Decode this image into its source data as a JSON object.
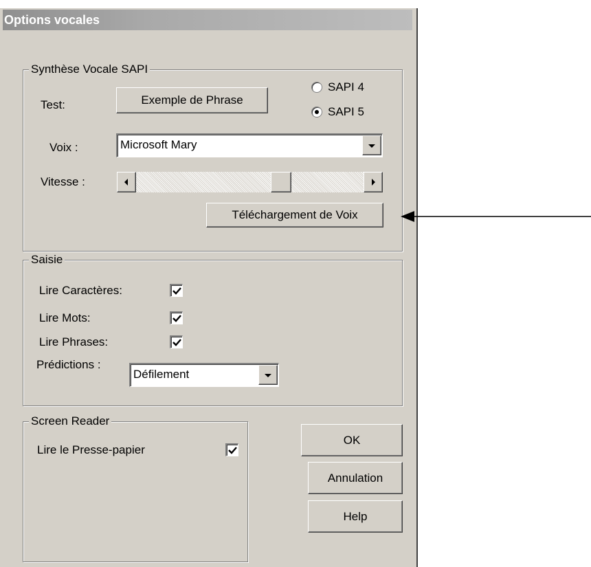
{
  "dialog": {
    "title": "Options vocales"
  },
  "synthesis": {
    "legend": "Synthèse Vocale SAPI",
    "test_label": "Test:",
    "sample_button": "Exemple de Phrase",
    "sapi_options": [
      {
        "label": "SAPI 4",
        "selected": false
      },
      {
        "label": "SAPI 5",
        "selected": true
      }
    ],
    "voice_label": "Voix :",
    "voice_value": "Microsoft Mary",
    "speed_label": "Vitesse :",
    "speed_level": 0.65,
    "download_button": "Téléchargement de Voix"
  },
  "input": {
    "legend": "Saisie",
    "read_characters_label": "Lire Caractères:",
    "read_characters_checked": true,
    "read_words_label": "Lire Mots:",
    "read_words_checked": true,
    "read_sentences_label": "Lire Phrases:",
    "read_sentences_checked": true,
    "predictions_label": "Prédictions :",
    "predictions_value": "Défilement"
  },
  "screen_reader": {
    "legend": "Screen Reader",
    "clipboard_label": "Lire le Presse-papier",
    "clipboard_checked": true
  },
  "buttons": {
    "ok": "OK",
    "cancel": "Annulation",
    "help": "Help"
  },
  "icons": {
    "dropdown": "chevron-down-icon",
    "scroll_left": "arrow-left-icon",
    "scroll_right": "arrow-right-icon",
    "check": "check-icon",
    "pointer": "arrow-pointer-icon"
  }
}
